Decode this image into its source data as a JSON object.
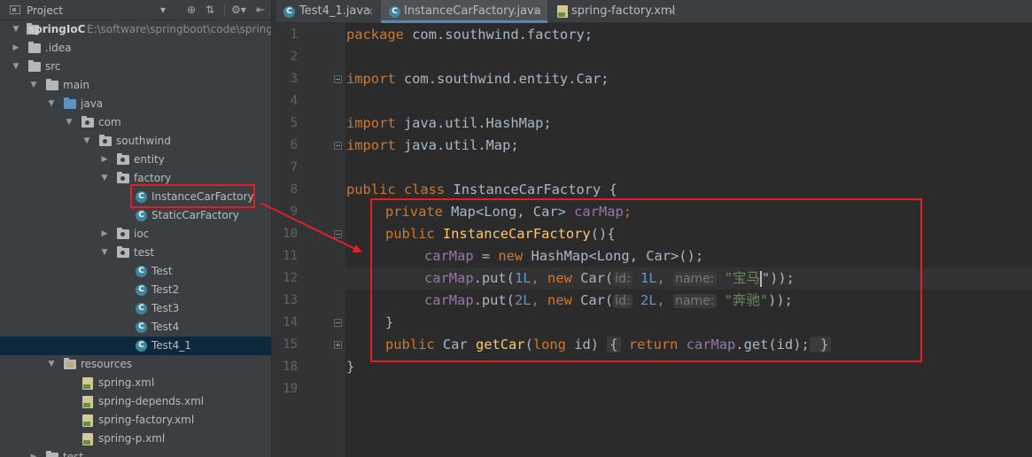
{
  "project_panel": {
    "title": "Project",
    "header_buttons": [
      "▾",
      "⊕",
      "⇅",
      "⚙▾",
      "⇤"
    ]
  },
  "tree": [
    {
      "label": "springIoC",
      "note": "E:\\software\\springboot\\code\\spring",
      "kind": "module",
      "expanded": true
    },
    {
      "label": ".idea",
      "kind": "folder",
      "expanded": false
    },
    {
      "label": "src",
      "kind": "folder",
      "expanded": true
    },
    {
      "label": "main",
      "kind": "folder",
      "expanded": true
    },
    {
      "label": "java",
      "kind": "source-folder",
      "expanded": true
    },
    {
      "label": "com",
      "kind": "package",
      "expanded": true
    },
    {
      "label": "southwind",
      "kind": "package",
      "expanded": true
    },
    {
      "label": "entity",
      "kind": "package",
      "expanded": false
    },
    {
      "label": "factory",
      "kind": "package",
      "expanded": true
    },
    {
      "label": "InstanceCarFactory",
      "kind": "class"
    },
    {
      "label": "StaticCarFactory",
      "kind": "class"
    },
    {
      "label": "ioc",
      "kind": "package",
      "expanded": false
    },
    {
      "label": "test",
      "kind": "package",
      "expanded": true
    },
    {
      "label": "Test",
      "kind": "class"
    },
    {
      "label": "Test2",
      "kind": "class"
    },
    {
      "label": "Test3",
      "kind": "class"
    },
    {
      "label": "Test4",
      "kind": "class"
    },
    {
      "label": "Test4_1",
      "kind": "class",
      "selected": true
    },
    {
      "label": "resources",
      "kind": "resources-folder",
      "expanded": true
    },
    {
      "label": "spring.xml",
      "kind": "xml"
    },
    {
      "label": "spring-depends.xml",
      "kind": "xml"
    },
    {
      "label": "spring-factory.xml",
      "kind": "xml"
    },
    {
      "label": "spring-p.xml",
      "kind": "xml"
    },
    {
      "label": "test",
      "kind": "folder",
      "expanded": false
    }
  ],
  "tabs": [
    {
      "label": "Test4_1.java",
      "icon": "class-icon",
      "close": "×"
    },
    {
      "label": "InstanceCarFactory.java",
      "icon": "class-icon",
      "active": true,
      "close": "×"
    },
    {
      "label": "spring-factory.xml",
      "icon": "xml-file-icon",
      "close": "×"
    }
  ],
  "line_numbers": [
    "1",
    "2",
    "3",
    "4",
    "5",
    "6",
    "7",
    "8",
    "9",
    "10",
    "11",
    "12",
    "13",
    "14",
    "15",
    "18",
    "19"
  ],
  "code": {
    "l1": [
      "package",
      " com.southwind.factory;"
    ],
    "l3": [
      "import",
      " com.southwind.entity.Car;"
    ],
    "l5": [
      "import",
      " java.util.HashMap;"
    ],
    "l6": [
      "import",
      " java.util.Map;"
    ],
    "l8": [
      "public class",
      " InstanceCarFactory {"
    ],
    "l9": [
      "private",
      " Map<Long, Car> ",
      "carMap",
      ";"
    ],
    "l10": [
      "public",
      " ",
      "InstanceCarFactory",
      "(){"
    ],
    "l11": [
      "carMap",
      " = ",
      "new",
      " HashMap<Long, Car>();"
    ],
    "l12": [
      "carMap",
      ".put(",
      "1L",
      ", ",
      "new",
      " Car(",
      "id:",
      " ",
      "1L",
      ", ",
      "name:",
      " ",
      "\"宝马",
      "\"));"
    ],
    "l13": [
      "carMap",
      ".put(",
      "2L",
      ", ",
      "new",
      " Car(",
      "id:",
      " ",
      "2L",
      ", ",
      "name:",
      " ",
      "\"奔驰\"",
      "));"
    ],
    "l14": [
      "}"
    ],
    "l15": [
      "public",
      " Car ",
      "getCar",
      "(",
      "long",
      " id) ",
      "{",
      " ",
      "return",
      " ",
      "carMap",
      ".get(id);",
      " }"
    ],
    "l18": [
      "}"
    ]
  },
  "colors": {
    "keyword": "#cc7832",
    "field": "#9876aa",
    "method": "#ffc66d",
    "number": "#6897bb",
    "string": "#6a8759",
    "annotation": "#e31e24",
    "selection": "#0d293e"
  }
}
